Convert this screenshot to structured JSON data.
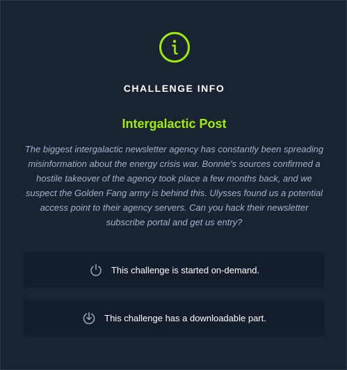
{
  "header": {
    "icon": "info-circle-icon",
    "heading": "CHALLENGE INFO"
  },
  "challenge": {
    "title": "Intergalactic Post",
    "description": "The biggest intergalactic newsletter agency has constantly been spreading misinformation about the energy crisis war. Bonnie's sources confirmed a hostile takeover of the agency took place a few months back, and we suspect the Golden Fang army is behind this. Ulysses found us a potential access point to their agency servers. Can you hack their newsletter subscribe portal and get us entry?"
  },
  "notes": [
    {
      "icon": "power-icon",
      "text": "This challenge is started on-demand."
    },
    {
      "icon": "download-icon",
      "text": "This challenge has a downloadable part."
    }
  ],
  "colors": {
    "background": "#1a2332",
    "accent": "#9fef00",
    "note_background": "#141d2b",
    "text_muted": "#a4b1cd",
    "icon_muted": "#a4b1cd"
  }
}
